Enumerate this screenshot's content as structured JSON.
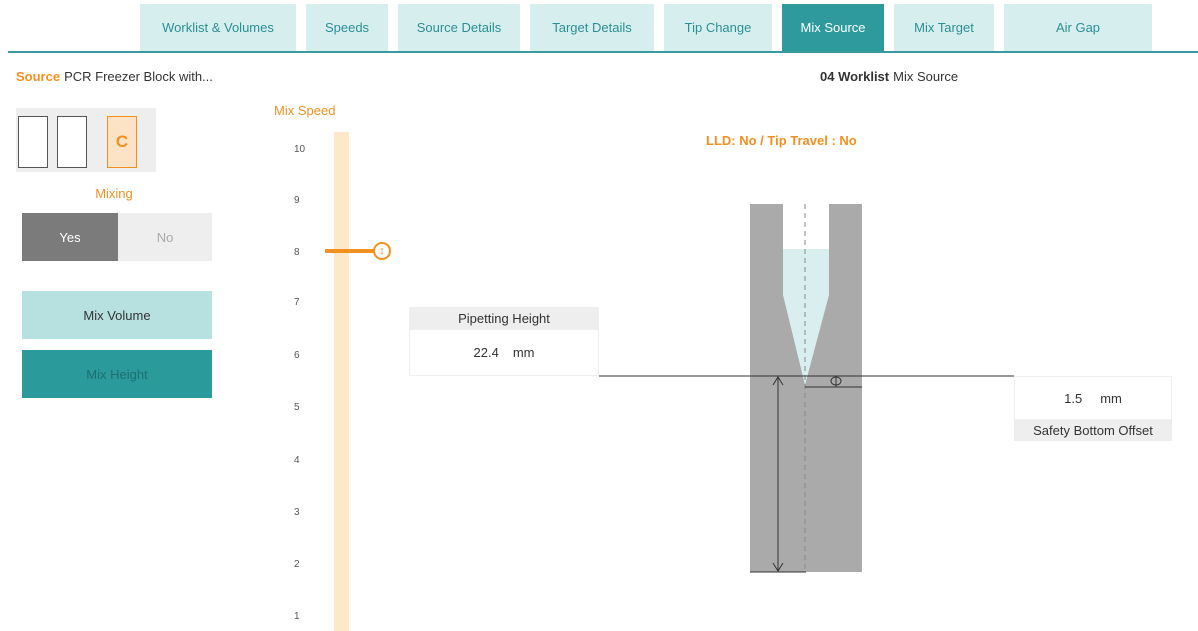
{
  "tabs": [
    {
      "label": "Worklist & Volumes",
      "active": false
    },
    {
      "label": "Speeds",
      "active": false
    },
    {
      "label": "Source Details",
      "active": false
    },
    {
      "label": "Target Details",
      "active": false
    },
    {
      "label": "Tip Change",
      "active": false
    },
    {
      "label": "Mix Source",
      "active": true
    },
    {
      "label": "Mix Target",
      "active": false
    },
    {
      "label": "Air Gap",
      "active": false
    }
  ],
  "source": {
    "keyword": "Source",
    "name": "PCR Freezer Block with..."
  },
  "worklist": {
    "keyword": "04 Worklist",
    "name": "Mix Source"
  },
  "plates": {
    "selected_label": "C"
  },
  "mixing": {
    "label": "Mixing",
    "yes": "Yes",
    "no": "No",
    "selected": "Yes"
  },
  "buttons": {
    "mix_volume": "Mix Volume",
    "mix_height": "Mix Height"
  },
  "mix_speed": {
    "label": "Mix Speed",
    "ticks": [
      "10",
      "9",
      "8",
      "7",
      "6",
      "5",
      "4",
      "3",
      "2",
      "1"
    ],
    "value": 8
  },
  "lld_text": "LLD: No / Tip Travel : No",
  "pipetting_height": {
    "label": "Pipetting Height",
    "value": "22.4",
    "unit": "mm"
  },
  "safety_offset": {
    "label": "Safety Bottom Offset",
    "value": "1.5",
    "unit": "mm"
  },
  "colors": {
    "accent": "#f29020",
    "teal": "#2e9a9e",
    "tab_bg": "#d7eeee"
  }
}
